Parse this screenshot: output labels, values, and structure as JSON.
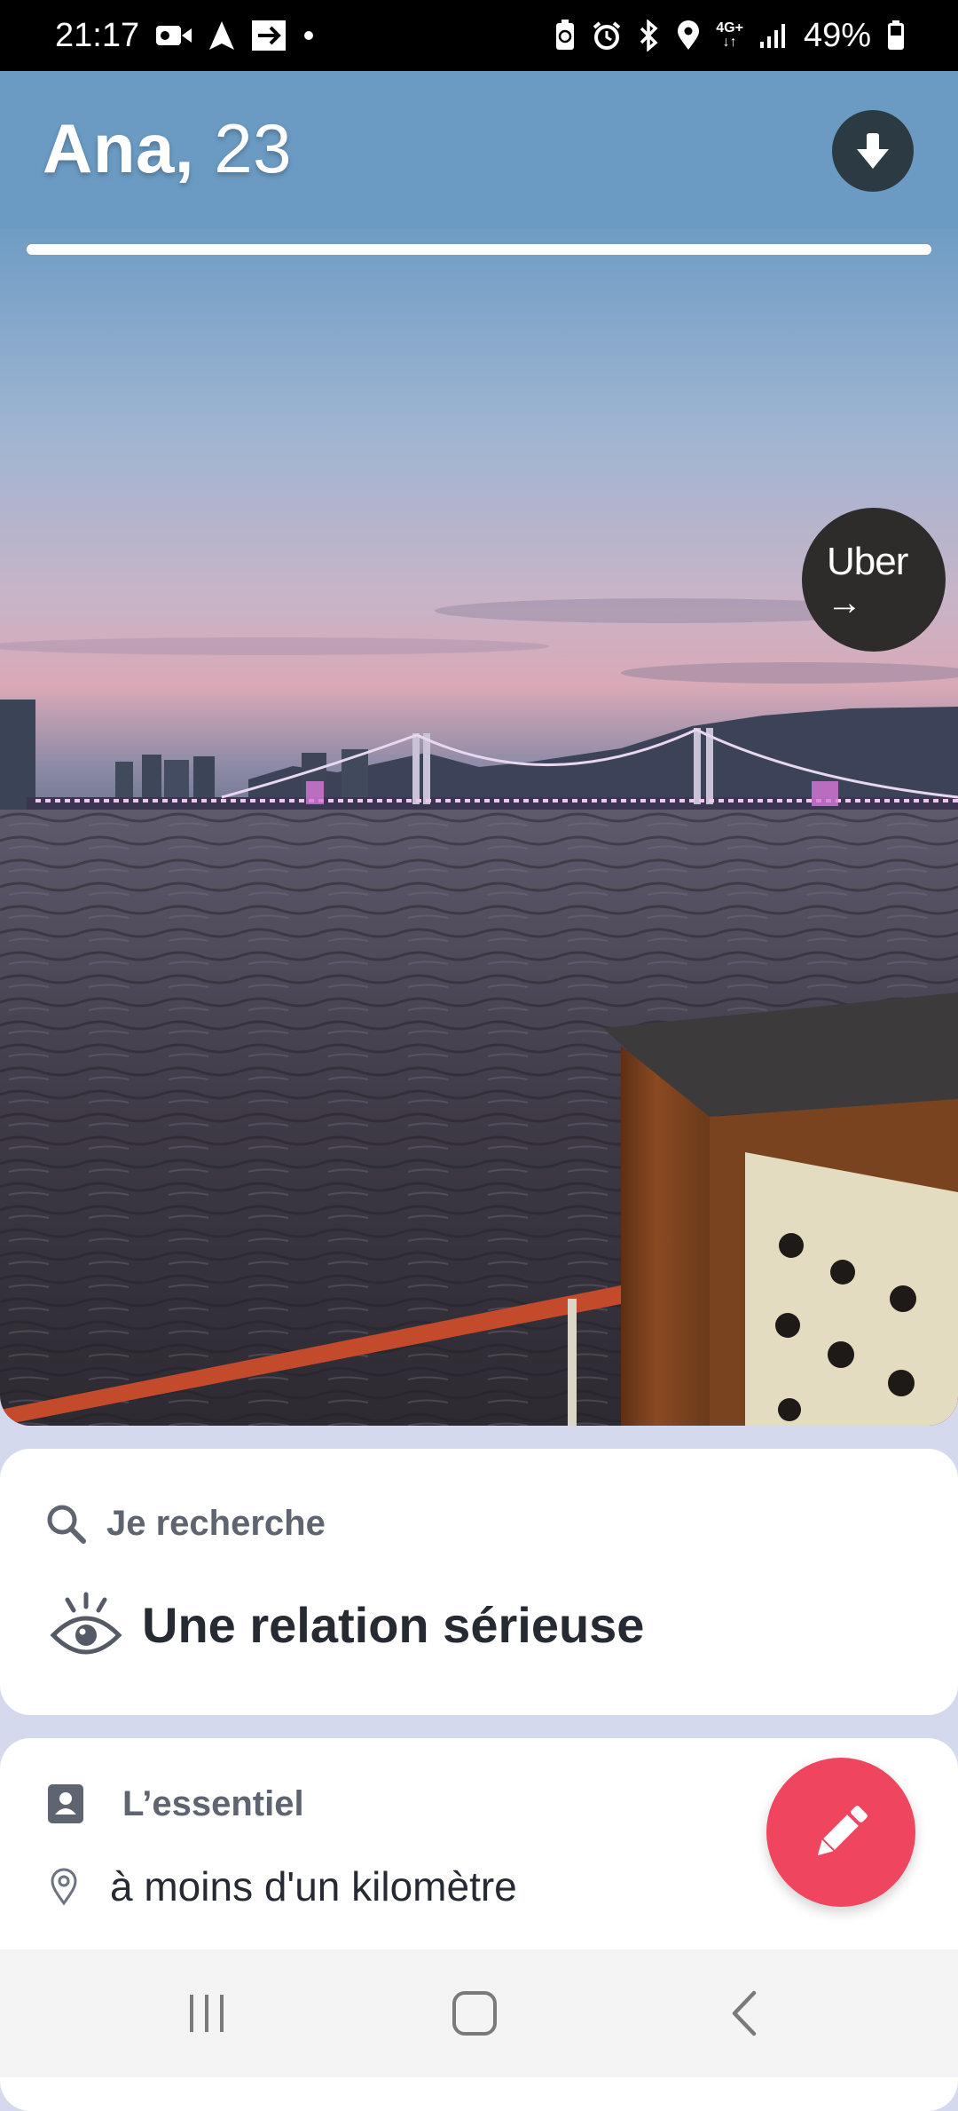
{
  "status_bar": {
    "time": "21:17",
    "network": "4G+",
    "battery": "49%",
    "left_icons": [
      "video-camera-icon",
      "navigation-arrow-icon",
      "forward-box-icon",
      "dot-icon"
    ],
    "right_icons": [
      "battery-saver-icon",
      "alarm-icon",
      "bluetooth-icon",
      "location-icon",
      "network-4g-icon",
      "signal-icon",
      "battery-icon"
    ]
  },
  "header": {
    "name": "Ana,",
    "age": "23",
    "background": "#6b9bc3",
    "action_icon": "download-arrow-icon"
  },
  "photo": {
    "progress": 1.0,
    "badge": {
      "text": "Uber",
      "arrow": "→"
    }
  },
  "looking_for": {
    "label": "Je recherche",
    "label_icon": "search-icon",
    "value": "Une relation sérieuse",
    "value_icon": "eye-icon"
  },
  "essentials": {
    "label": "L’essentiel",
    "label_icon": "profile-card-icon",
    "items": [
      {
        "icon": "location-pin-icon",
        "text": "à moins d'un kilomètre"
      }
    ]
  },
  "fab": {
    "icon": "pencil-icon",
    "color": "#f0455e"
  },
  "nav_bar": {
    "buttons": [
      "recent-apps-icon",
      "home-icon",
      "back-icon"
    ]
  }
}
